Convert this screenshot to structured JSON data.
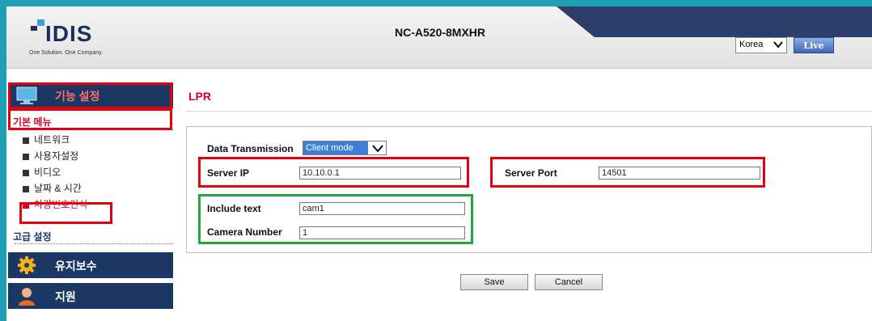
{
  "header": {
    "logo_text": "IDIS",
    "logo_tagline": "One Solution. One Company.",
    "model": "NC-A520-8MXHR",
    "language": "Korea",
    "live_label": "Live"
  },
  "sidebar": {
    "menu_setup": "기능 설정",
    "basic_menu": "기본 메뉴",
    "items": [
      {
        "label": "네트워크"
      },
      {
        "label": "사용자설정"
      },
      {
        "label": "비디오"
      },
      {
        "label": "날짜 & 시간"
      },
      {
        "label": "차량번호인식"
      }
    ],
    "advanced": "고급 설정",
    "maintenance": "유지보수",
    "support": "지원"
  },
  "content": {
    "title": "LPR",
    "data_transmission_label": "Data Transmission",
    "data_transmission_value": "Client mode",
    "server_ip_label": "Server IP",
    "server_ip_value": "10.10.0.1",
    "server_port_label": "Server Port",
    "server_port_value": "14501",
    "include_text_label": "Include text",
    "include_text_value": "cam1",
    "camera_number_label": "Camera Number",
    "camera_number_value": "1",
    "save_label": "Save",
    "cancel_label": "Cancel"
  },
  "colors": {
    "highlight_red": "#e3000f",
    "highlight_green": "#1fa93a",
    "nav_dark": "#1b3763"
  }
}
